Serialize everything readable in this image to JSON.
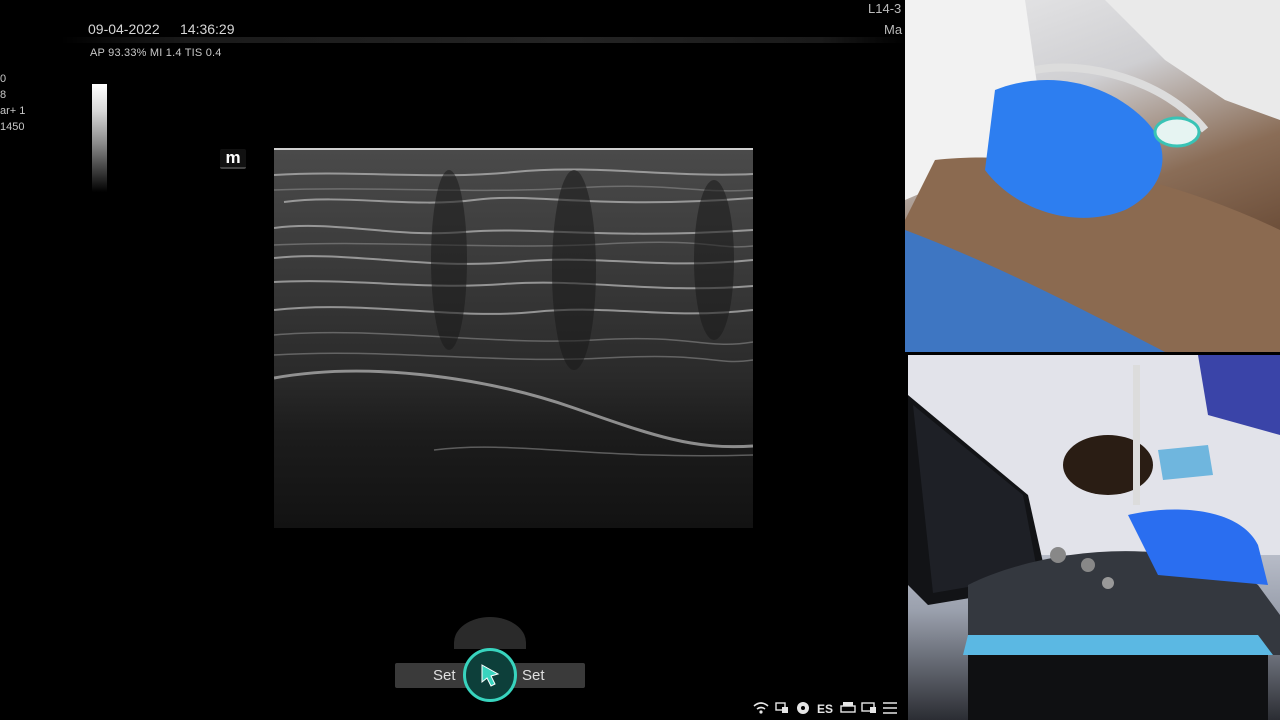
{
  "header": {
    "date": "09-04-2022",
    "time": "14:36:29",
    "probe": "L14-3",
    "preset": "Ma",
    "acoustic": "AP 93.33%  MI 1.4 TIS 0.4"
  },
  "params": [
    "0",
    "8",
    "ar+ 1",
    "1450"
  ],
  "logo": "m",
  "set_bar": {
    "left_label": "Set",
    "right_label": "Set"
  },
  "status_icons": [
    "wifi-icon",
    "network-icon",
    "usb-icon",
    "es-label",
    "printer-icon",
    "display-icon",
    "menu-icon"
  ],
  "status_text": "ES",
  "colors": {
    "accent": "#38d4be",
    "background": "#000000"
  }
}
